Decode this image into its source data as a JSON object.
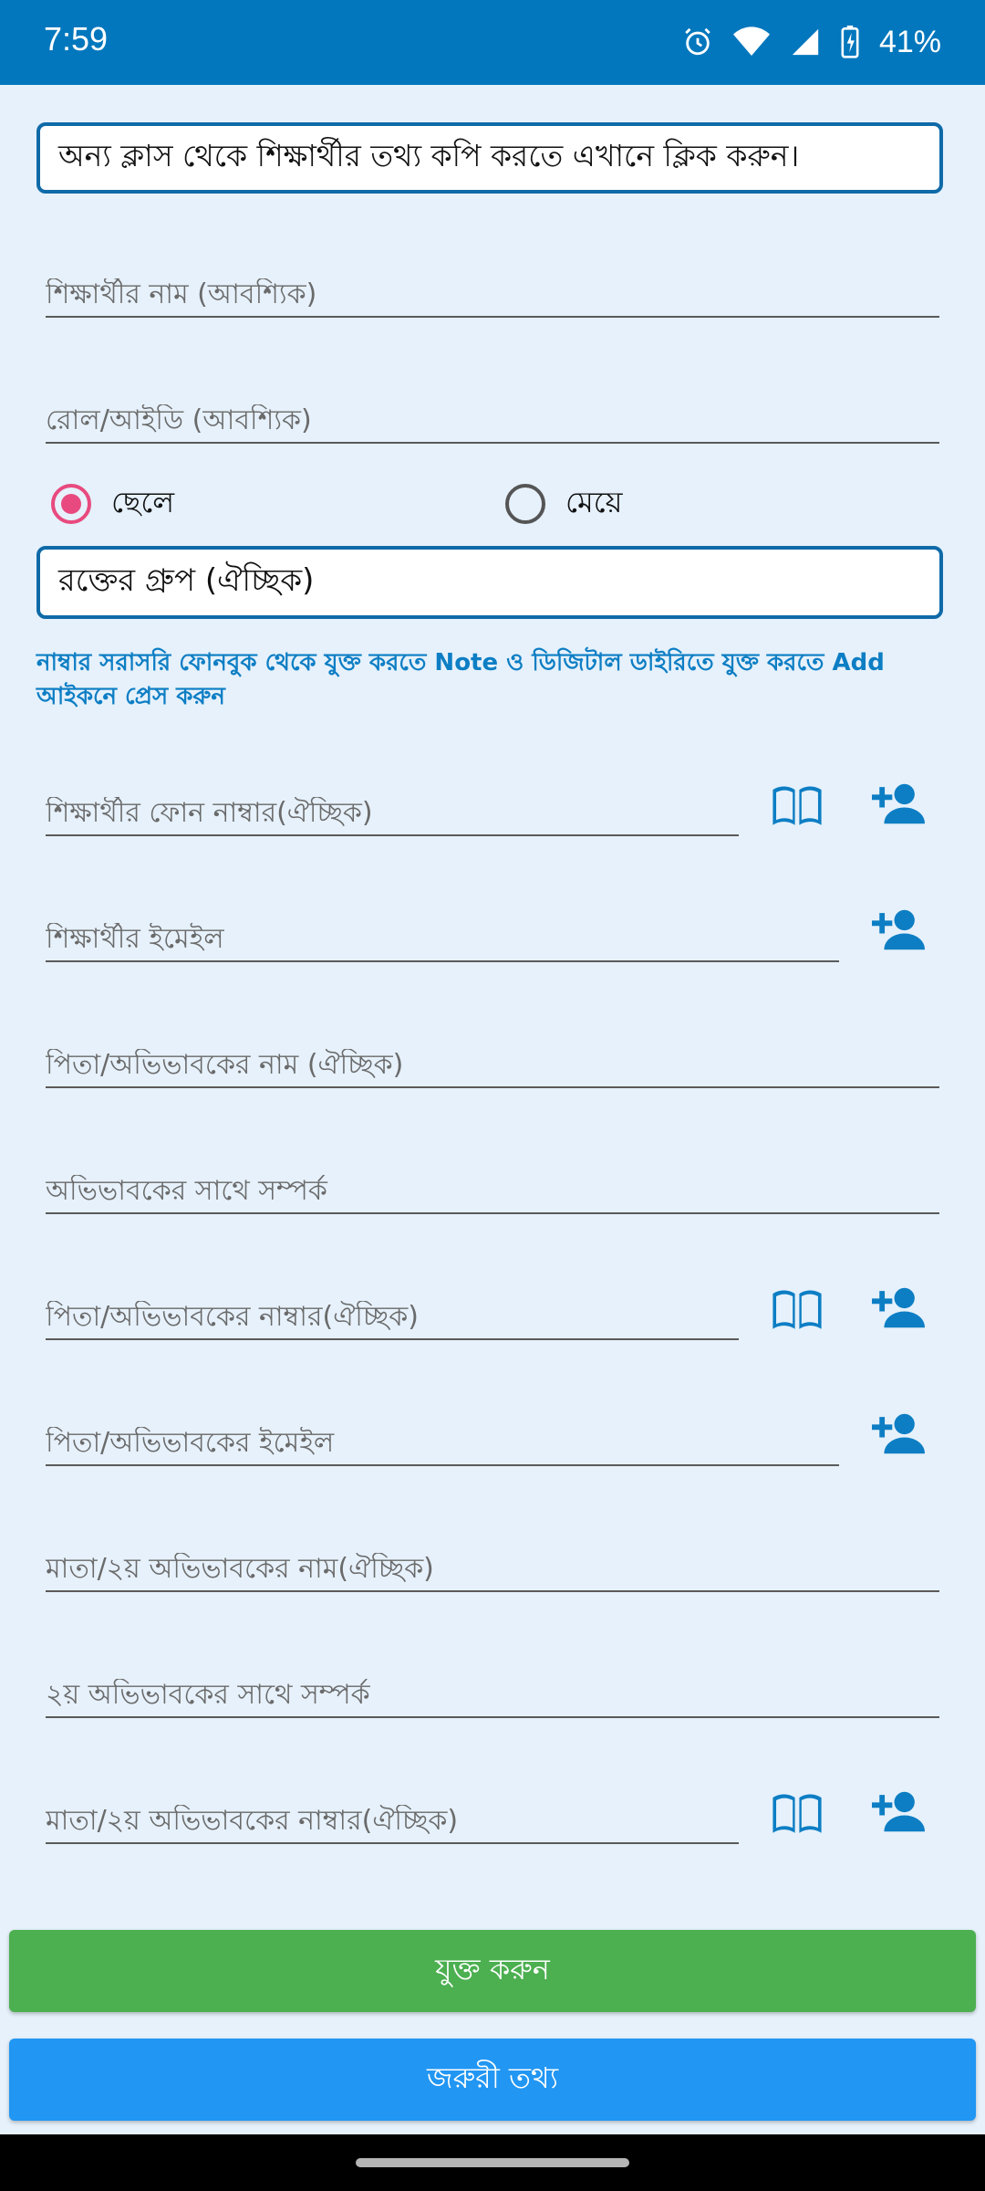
{
  "status_bar": {
    "time": "7:59",
    "battery": "41%",
    "icons": [
      "alarm-icon",
      "wifi-icon",
      "signal-icon",
      "battery-charging-icon"
    ]
  },
  "copy_prompt": "অন্য ক্লাস থেকে শিক্ষার্থীর তথ্য কপি করতে এখানে ক্লিক করুন।",
  "fields": {
    "student_name": "শিক্ষার্থীর নাম (আবশ্যিক)",
    "roll_id": "রোল/আইডি (আবশ্যিক)",
    "student_phone": "শিক্ষার্থীর ফোন নাম্বার(ঐচ্ছিক)",
    "student_email": "শিক্ষার্থীর ইমেইল",
    "father_name": "পিতা/অভিভাবকের নাম (ঐচ্ছিক)",
    "guardian_relation": "অভিভাবকের সাথে সম্পর্ক",
    "father_phone": "পিতা/অভিভাবকের নাম্বার(ঐচ্ছিক)",
    "father_email": "পিতা/অভিভাবকের ইমেইল",
    "mother_name": "মাতা/২য় অভিভাবকের নাম(ঐচ্ছিক)",
    "guardian2_relation": "২য় অভিভাবকের সাথে সম্পর্ক",
    "mother_phone": "মাতা/২য় অভিভাবকের নাম্বার(ঐচ্ছিক)"
  },
  "gender": {
    "male": "ছেলে",
    "female": "মেয়ে",
    "selected": "male"
  },
  "blood_group": "রক্তের গ্রুপ (ঐচ্ছিক)",
  "hint": "নাম্বার সরাসরি ফোনবুক থেকে যুক্ত করতে Note ও ডিজিটাল ডাইরিতে যুক্ত করতে Add আইকনে প্রেস করুন",
  "buttons": {
    "add": "যুক্ত করুন",
    "important_info": "জরুরী তথ্য"
  },
  "colors": {
    "status_bar": "#0277bd",
    "accent_blue": "#0f6aa8",
    "radio_pink": "#e84a7f",
    "add_green": "#4caf50",
    "info_blue": "#2196f3",
    "background": "#e6f1fb"
  }
}
